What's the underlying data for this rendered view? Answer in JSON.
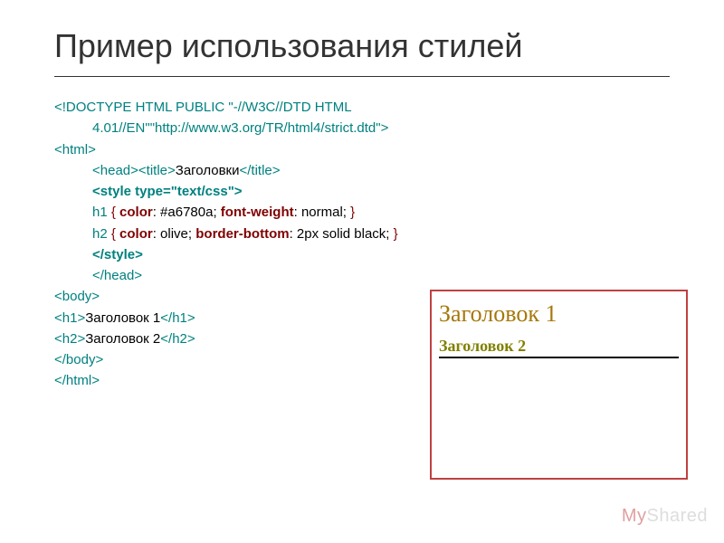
{
  "title": "Пример использования стилей",
  "code": {
    "l1": "<!DOCTYPE HTML PUBLIC \"-//W3C//DTD HTML",
    "l2": "4.01//EN\"\"http://www.w3.org/TR/html4/strict.dtd\">",
    "l3": "<html>",
    "l4a": "<head><title>",
    "l4b": "Заголовки",
    "l4c": "</title>",
    "l5": "<style type=\"text/css\">",
    "l6a": "h1 ",
    "l6b": "{",
    "l6c": " color",
    "l6d": ": #a6780a; ",
    "l6e": "font-weight",
    "l6f": ": normal; ",
    "l6g": "}",
    "l7a": "h2 ",
    "l7b": "{",
    "l7c": " color",
    "l7d": ": olive; ",
    "l7e": "border-bottom",
    "l7f": ": 2px solid black; ",
    "l7g": "}",
    "l8": "</style>",
    "l9": "</head>",
    "l10": "<body>",
    "l11a": "<h1>",
    "l11b": "Заголовок 1",
    "l11c": "</h1>",
    "l12a": "<h2>",
    "l12b": "Заголовок 2",
    "l12c": "</h2>",
    "l13": "</body>",
    "l14": "</html>"
  },
  "preview": {
    "h1": "Заголовок 1",
    "h2": "Заголовок 2"
  },
  "watermark": {
    "a": "My",
    "b": "Shared"
  }
}
